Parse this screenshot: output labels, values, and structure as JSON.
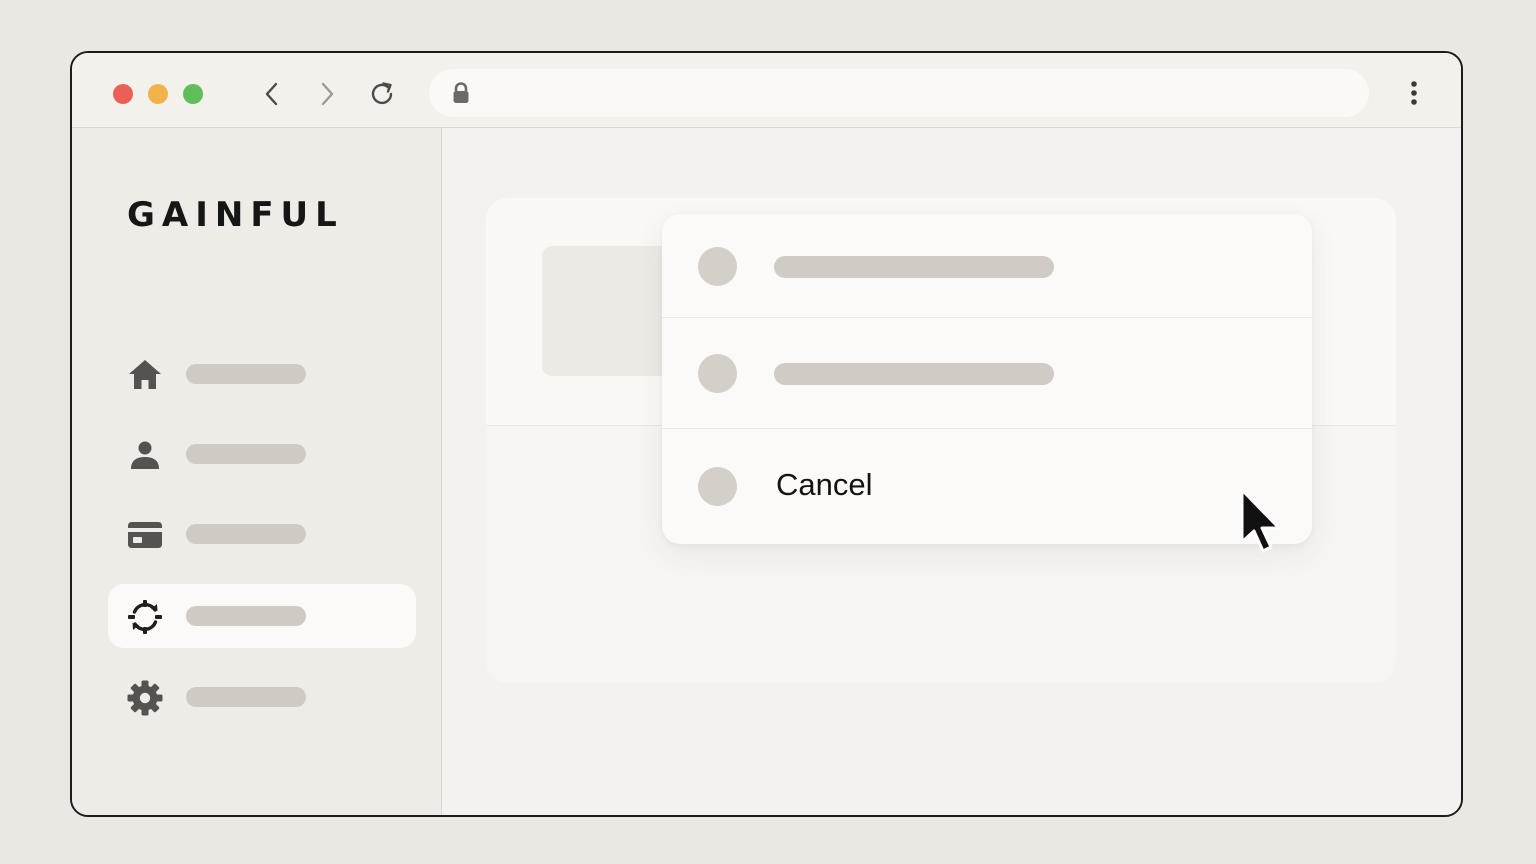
{
  "browser": {
    "window_controls": [
      {
        "name": "close",
        "color": "#ec5f57"
      },
      {
        "name": "minimize",
        "color": "#f2b24b"
      },
      {
        "name": "maximize",
        "color": "#5fbe5a"
      }
    ],
    "nav_icons": [
      "chevron-left-icon",
      "chevron-right-icon",
      "reload-icon"
    ],
    "address_bar": {
      "icon": "lock-icon",
      "value": ""
    },
    "menu_icon": "kebab-menu-icon"
  },
  "sidebar": {
    "logo": "GAINFUL",
    "items": [
      {
        "icon": "home-icon",
        "label": "",
        "active": false
      },
      {
        "icon": "user-icon",
        "label": "",
        "active": false
      },
      {
        "icon": "credit-card-icon",
        "label": "",
        "active": false
      },
      {
        "icon": "sync-icon",
        "label": "",
        "active": true
      },
      {
        "icon": "gear-icon",
        "label": "",
        "active": false
      }
    ]
  },
  "action_sheet": {
    "options": [
      {
        "label": ""
      },
      {
        "label": ""
      },
      {
        "label": "Cancel"
      }
    ]
  },
  "colors": {
    "background": "#ebe8e3",
    "placeholder": "#cfcbc4",
    "active_item": "#fbfaf8"
  }
}
